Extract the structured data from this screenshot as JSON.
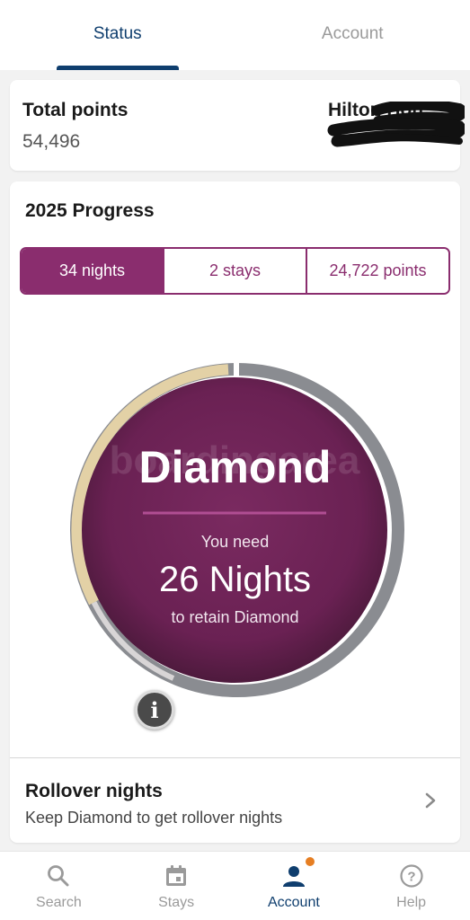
{
  "top_tabs": [
    {
      "label": "Status",
      "active": true
    },
    {
      "label": "Account",
      "active": false
    }
  ],
  "points_card": {
    "total_label": "Total points",
    "total_value": "54,496",
    "program_label": "Hilton Hon"
  },
  "progress": {
    "title": "2025 Progress",
    "segments": [
      {
        "label": "34 nights",
        "active": true
      },
      {
        "label": "2 stays",
        "active": false
      },
      {
        "label": "24,722 points",
        "active": false
      }
    ],
    "ring": {
      "tier": "Diamond",
      "watermark": "boardingarea",
      "need_label": "You need",
      "nights_value": "26 Nights",
      "retain_label": "to retain Diamond",
      "progress_fraction": 0.3
    },
    "info_icon": "info-icon"
  },
  "rollover": {
    "title": "Rollover nights",
    "subtitle": "Keep Diamond to get rollover nights"
  },
  "bottom_nav": [
    {
      "label": "Search",
      "icon": "search-icon",
      "active": false
    },
    {
      "label": "Stays",
      "icon": "calendar-icon",
      "active": false
    },
    {
      "label": "Account",
      "icon": "account-icon",
      "active": true,
      "badge": true
    },
    {
      "label": "Help",
      "icon": "help-icon",
      "active": false
    }
  ],
  "colors": {
    "brand_navy": "#0f3e6e",
    "diamond_purple": "#6d2355",
    "segment_purple": "#8a2d6e",
    "gold_ring": "#e3d1a6",
    "gray_ring": "#8a8c91",
    "badge_orange": "#e67e22"
  }
}
